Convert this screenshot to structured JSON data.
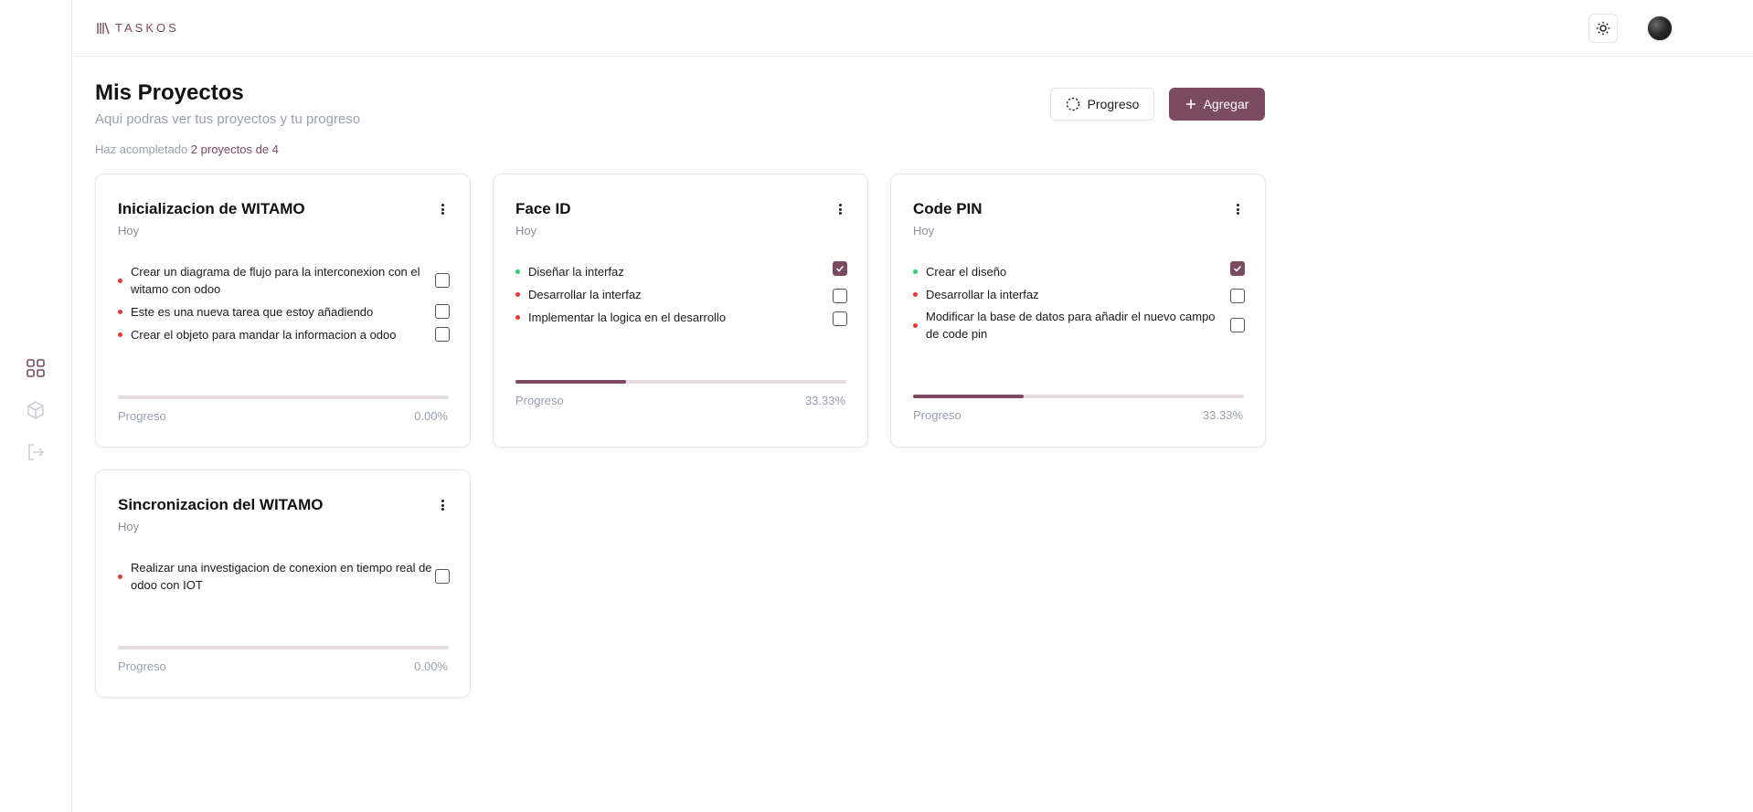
{
  "app": {
    "logo_text": "TASKOS"
  },
  "header": {
    "title": "Mis Proyectos",
    "subtitle": "Aqui podras ver tus proyectos y tu progreso",
    "summary_prefix": "Haz acompletado",
    "summary_highlight": "2 proyectos de 4"
  },
  "actions": {
    "progress_label": "Progreso",
    "add_label": "Agregar"
  },
  "colors": {
    "accent": "#7b4a63",
    "pending": "#e53935",
    "done": "#2ecc71",
    "muted": "#9aa1ad"
  },
  "sidebar": {
    "items": [
      {
        "icon": "grid-icon",
        "active": true
      },
      {
        "icon": "cube-icon",
        "active": false
      },
      {
        "icon": "logout-icon",
        "active": false
      }
    ]
  },
  "projects": [
    {
      "title": "Inicializacion de WITAMO",
      "date": "Hoy",
      "tasks": [
        {
          "text": "Crear un diagrama de flujo para la interconexion con el witamo con odoo",
          "done": false
        },
        {
          "text": "Este es una nueva tarea que estoy añadiendo",
          "done": false
        },
        {
          "text": "Crear el objeto para mandar la informacion a odoo",
          "done": false
        }
      ],
      "progress_label": "Progreso",
      "progress_text": "0.00%",
      "progress": 0
    },
    {
      "title": "Face ID",
      "date": "Hoy",
      "tasks": [
        {
          "text": "Diseñar la interfaz",
          "done": true
        },
        {
          "text": "Desarrollar la interfaz",
          "done": false
        },
        {
          "text": "Implementar la logica en el desarrollo",
          "done": false
        }
      ],
      "progress_label": "Progreso",
      "progress_text": "33.33%",
      "progress": 33.33
    },
    {
      "title": "Code PIN",
      "date": "Hoy",
      "tasks": [
        {
          "text": "Crear el diseño",
          "done": true
        },
        {
          "text": "Desarrollar la interfaz",
          "done": false
        },
        {
          "text": "Modificar la base de datos para añadir el nuevo campo de code pin",
          "done": false
        }
      ],
      "progress_label": "Progreso",
      "progress_text": "33.33%",
      "progress": 33.33
    },
    {
      "title": "Sincronizacion del WITAMO",
      "date": "Hoy",
      "tasks": [
        {
          "text": "Realizar una investigacion de conexion en tiempo real de odoo con IOT",
          "done": false
        }
      ],
      "progress_label": "Progreso",
      "progress_text": "0.00%",
      "progress": 0
    }
  ]
}
